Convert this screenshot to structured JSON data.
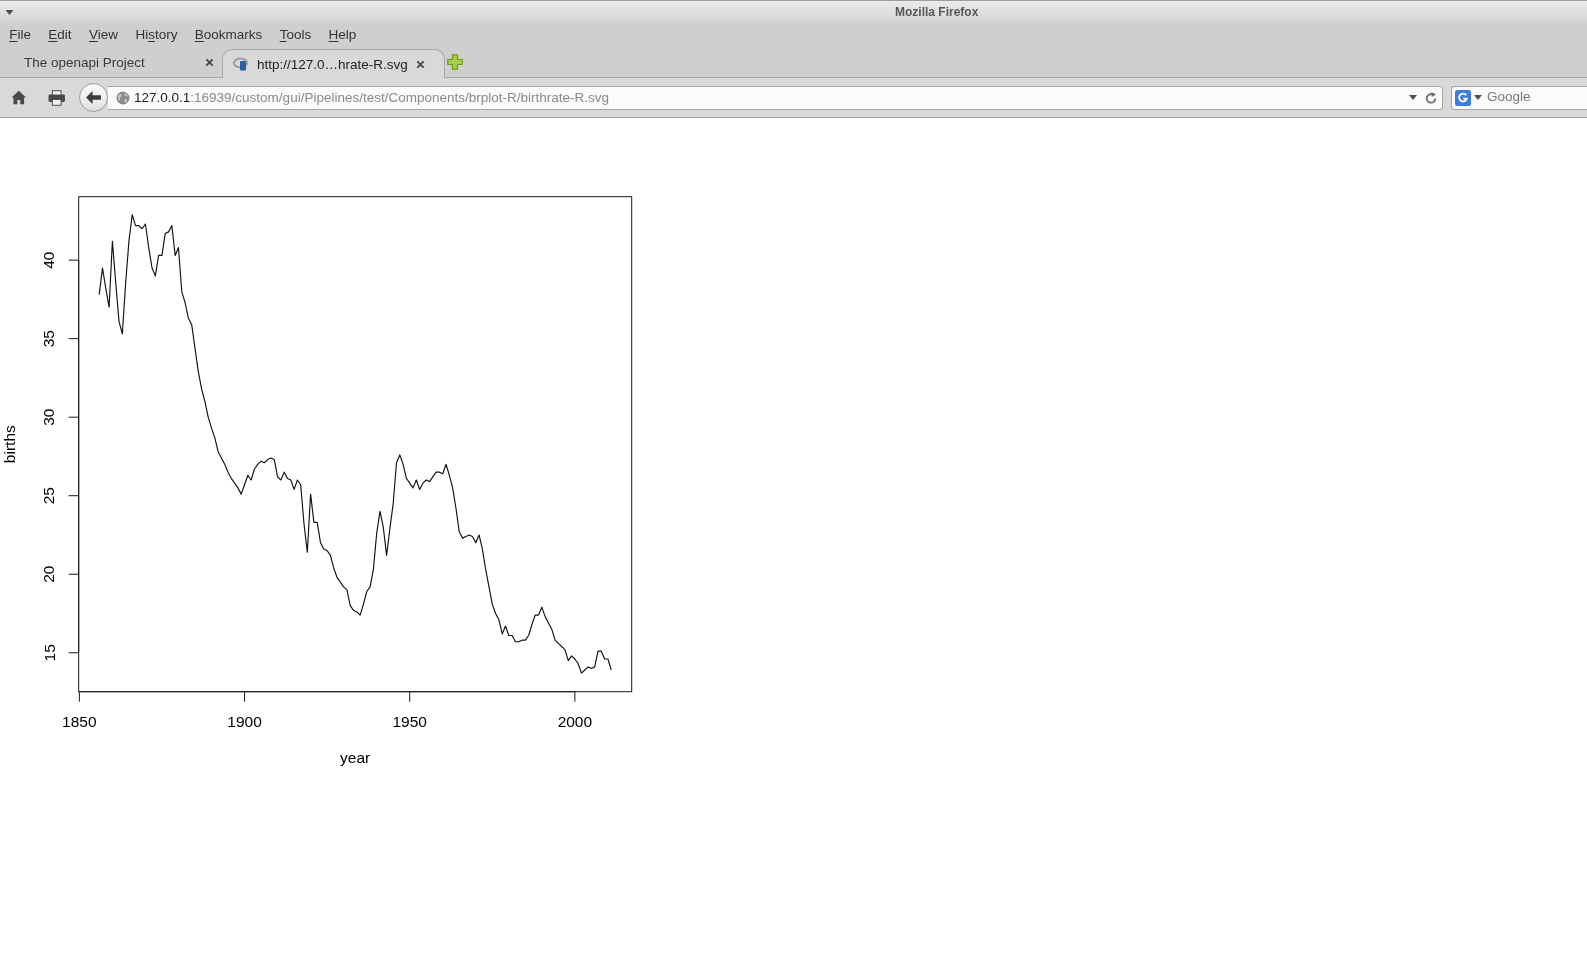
{
  "window": {
    "title": "Mozilla Firefox"
  },
  "menu": [
    {
      "parts": [
        {
          "text": "F",
          "underlined": true
        },
        {
          "text": "ile",
          "underlined": false
        }
      ]
    },
    {
      "parts": [
        {
          "text": "E",
          "underlined": true
        },
        {
          "text": "dit",
          "underlined": false
        }
      ]
    },
    {
      "parts": [
        {
          "text": "V",
          "underlined": true
        },
        {
          "text": "iew",
          "underlined": false
        }
      ]
    },
    {
      "parts": [
        {
          "text": "Hi",
          "underlined": false
        },
        {
          "text": "s",
          "underlined": true
        },
        {
          "text": "tory",
          "underlined": false
        }
      ]
    },
    {
      "parts": [
        {
          "text": "B",
          "underlined": true
        },
        {
          "text": "ookmarks",
          "underlined": false
        }
      ]
    },
    {
      "parts": [
        {
          "text": "T",
          "underlined": true
        },
        {
          "text": "ools",
          "underlined": false
        }
      ]
    },
    {
      "parts": [
        {
          "text": "H",
          "underlined": true
        },
        {
          "text": "elp",
          "underlined": false
        }
      ]
    }
  ],
  "tabs": [
    {
      "title": "The openapi Project",
      "selected": false,
      "favicon": false
    },
    {
      "title": "http://127.0…hrate-R.svg",
      "selected": true,
      "favicon": true
    }
  ],
  "address_bar": {
    "host": "127.0.0.1",
    "path": ":16939/custom/gui/Pipelines/test/Components/brplot-R/birthrate-R.svg"
  },
  "search": {
    "placeholder": "Google"
  },
  "page": {
    "chart_data": {
      "type": "line",
      "xlabel": "year",
      "ylabel": "births",
      "xlim": [
        1849.8,
        2017.2
      ],
      "ylim": [
        12.52,
        44.04
      ],
      "xticks": [
        1850,
        1900,
        1950,
        2000
      ],
      "yticks": [
        15,
        20,
        25,
        30,
        35,
        40
      ],
      "x": [
        1856,
        1857,
        1858,
        1859,
        1860,
        1861,
        1862,
        1863,
        1864,
        1865,
        1866,
        1867,
        1868,
        1869,
        1870,
        1871,
        1872,
        1873,
        1874,
        1875,
        1876,
        1877,
        1878,
        1879,
        1880,
        1881,
        1882,
        1883,
        1884,
        1885,
        1886,
        1887,
        1888,
        1889,
        1890,
        1891,
        1892,
        1893,
        1894,
        1895,
        1896,
        1897,
        1898,
        1899,
        1900,
        1901,
        1902,
        1903,
        1904,
        1905,
        1906,
        1907,
        1908,
        1909,
        1910,
        1911,
        1912,
        1913,
        1914,
        1915,
        1916,
        1917,
        1918,
        1919,
        1920,
        1921,
        1922,
        1923,
        1924,
        1925,
        1926,
        1927,
        1928,
        1929,
        1930,
        1931,
        1932,
        1933,
        1934,
        1935,
        1936,
        1937,
        1938,
        1939,
        1940,
        1941,
        1942,
        1943,
        1944,
        1945,
        1946,
        1947,
        1948,
        1949,
        1950,
        1951,
        1952,
        1953,
        1954,
        1955,
        1956,
        1957,
        1958,
        1959,
        1960,
        1961,
        1962,
        1963,
        1964,
        1965,
        1966,
        1967,
        1968,
        1969,
        1970,
        1971,
        1972,
        1973,
        1974,
        1975,
        1976,
        1977,
        1978,
        1979,
        1980,
        1981,
        1982,
        1983,
        1984,
        1985,
        1986,
        1987,
        1988,
        1989,
        1990,
        1991,
        1992,
        1993,
        1994,
        1995,
        1996,
        1997,
        1998,
        1999,
        2000,
        2001,
        2002,
        2003,
        2004,
        2005,
        2006,
        2007,
        2008,
        2009,
        2010,
        2011
      ],
      "values": [
        37.8,
        39.5,
        38.2,
        37.0,
        41.2,
        38.6,
        36.1,
        35.3,
        38.5,
        41.2,
        42.9,
        42.2,
        42.2,
        42.0,
        42.3,
        40.8,
        39.5,
        39.0,
        40.3,
        40.3,
        41.7,
        41.8,
        42.2,
        40.3,
        40.8,
        38.0,
        37.3,
        36.3,
        35.9,
        34.4,
        32.9,
        31.8,
        31.0,
        30.0,
        29.3,
        28.7,
        27.8,
        27.4,
        27.0,
        26.5,
        26.1,
        25.8,
        25.5,
        25.1,
        25.7,
        26.3,
        26.0,
        26.7,
        27.0,
        27.2,
        27.1,
        27.3,
        27.4,
        27.3,
        26.2,
        26.0,
        26.5,
        26.1,
        26.0,
        25.4,
        26.0,
        25.7,
        23.2,
        21.4,
        25.1,
        23.3,
        23.3,
        22.0,
        21.6,
        21.5,
        21.2,
        20.4,
        19.8,
        19.5,
        19.2,
        19.0,
        18.0,
        17.7,
        17.6,
        17.4,
        18.1,
        18.9,
        19.2,
        20.3,
        22.6,
        24.0,
        23.0,
        21.2,
        22.9,
        24.5,
        27.1,
        27.6,
        27.0,
        26.1,
        25.8,
        25.5,
        26.0,
        25.4,
        25.8,
        26.0,
        25.9,
        26.2,
        26.5,
        26.5,
        26.4,
        27.0,
        26.3,
        25.5,
        24.2,
        22.7,
        22.3,
        22.4,
        22.5,
        22.4,
        22.0,
        22.5,
        21.6,
        20.3,
        19.2,
        18.1,
        17.5,
        17.1,
        16.2,
        16.7,
        16.1,
        16.1,
        15.7,
        15.7,
        15.8,
        15.8,
        16.1,
        16.8,
        17.4,
        17.4,
        17.9,
        17.3,
        16.9,
        16.5,
        15.8,
        15.6,
        15.4,
        15.2,
        14.5,
        14.8,
        14.6,
        14.3,
        13.7,
        13.9,
        14.1,
        14.0,
        14.1,
        15.1,
        15.1,
        14.6,
        14.6,
        13.9
      ]
    }
  }
}
